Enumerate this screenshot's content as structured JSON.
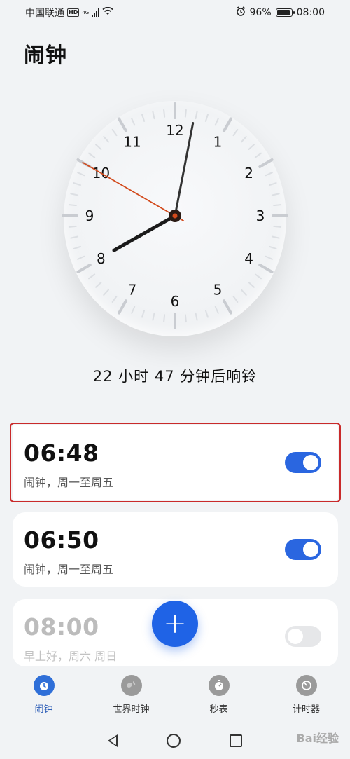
{
  "status_bar": {
    "carrier": "中国联通",
    "hd": "HD",
    "network": "4G",
    "battery": "96%",
    "time": "08:00"
  },
  "page_title": "闹钟",
  "clock": {
    "numbers": [
      "12",
      "1",
      "2",
      "3",
      "4",
      "5",
      "6",
      "7",
      "8",
      "9",
      "10",
      "11"
    ],
    "hour": 8,
    "minute": 1,
    "second": 50
  },
  "ring_text": "22 小时 47 分钟后响铃",
  "alarms": [
    {
      "time": "06:48",
      "label": "闹钟，周一至周五",
      "enabled": true
    },
    {
      "time": "06:50",
      "label": "闹钟，周一至周五",
      "enabled": true
    },
    {
      "time": "08:00",
      "label": "早上好，周六 周日",
      "enabled": false
    }
  ],
  "fab_label": "+",
  "bottom_nav": [
    {
      "label": "闹钟",
      "icon": "alarm-clock-icon",
      "active": true
    },
    {
      "label": "世界时钟",
      "icon": "globe-icon",
      "active": false
    },
    {
      "label": "秒表",
      "icon": "stopwatch-icon",
      "active": false
    },
    {
      "label": "计时器",
      "icon": "timer-icon",
      "active": false
    }
  ],
  "watermark": "Bai经验",
  "colors": {
    "accent": "#1f63e6",
    "toggle_on": "#2a66e0",
    "second_hand": "#d24a1c",
    "highlight": "#c92a2a"
  }
}
